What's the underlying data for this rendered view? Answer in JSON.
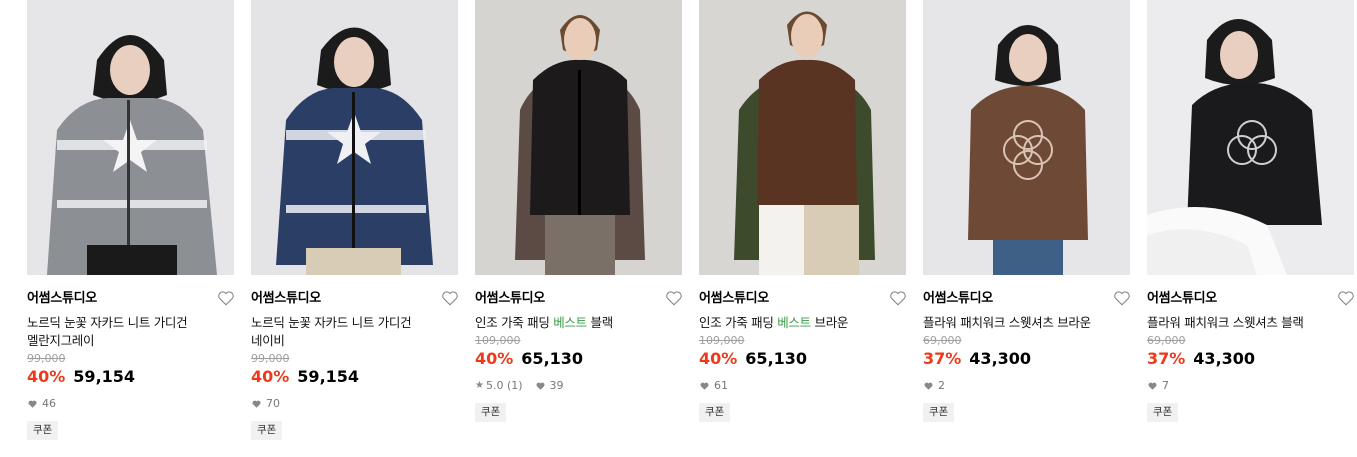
{
  "products": [
    {
      "brand": "어썸스튜디오",
      "name_line1": "노르딕 눈꽃 자카드 니트 가디건",
      "name_line2": "멜란지그레이",
      "original_price": "99,000",
      "discount": "40%",
      "price": "59,154",
      "rating": "",
      "likes": "46",
      "coupon": "쿠폰",
      "colors": {
        "bg": "#e6e6e8",
        "garment": "#8c8f94",
        "pattern": "#f4f4f4"
      }
    },
    {
      "brand": "어썸스튜디오",
      "name_line1": "노르딕 눈꽃 자카드 니트 가디건",
      "name_line2": "네이비",
      "original_price": "99,000",
      "discount": "40%",
      "price": "59,154",
      "rating": "",
      "likes": "70",
      "coupon": "쿠폰",
      "colors": {
        "bg": "#e4e4e6",
        "garment": "#2a3e66",
        "pattern": "#eef0f4"
      }
    },
    {
      "brand": "어썸스튜디오",
      "name_pre": "인조 가죽 패딩 ",
      "name_hl": "베스트",
      "name_post": " 블랙",
      "original_price": "109,000",
      "discount": "40%",
      "price": "65,130",
      "rating": "5.0 (1)",
      "likes": "39",
      "coupon": "쿠폰",
      "colors": {
        "bg": "#d6d4d1",
        "garment": "#1c1a1a",
        "pattern": "#5c4a45"
      }
    },
    {
      "brand": "어썸스튜디오",
      "name_pre": "인조 가죽 패딩 ",
      "name_hl": "베스트",
      "name_post": " 브라운",
      "original_price": "109,000",
      "discount": "40%",
      "price": "65,130",
      "rating": "",
      "likes": "61",
      "coupon": "쿠폰",
      "colors": {
        "bg": "#d8d6d3",
        "garment": "#5a3422",
        "pattern": "#3d4a2c"
      }
    },
    {
      "brand": "어썸스튜디오",
      "name_line1": "플라워 패치워크 스웻셔츠 브라운",
      "original_price": "69,000",
      "discount": "37%",
      "price": "43,300",
      "rating": "",
      "likes": "2",
      "coupon": "쿠폰",
      "colors": {
        "bg": "#e6e6e8",
        "garment": "#6e4a36",
        "pattern": "#d9c4b4"
      }
    },
    {
      "brand": "어썸스튜디오",
      "name_line1": "플라워 패치워크 스웻셔츠 블랙",
      "original_price": "69,000",
      "discount": "37%",
      "price": "43,300",
      "rating": "",
      "likes": "7",
      "coupon": "쿠폰",
      "colors": {
        "bg": "#ececee",
        "garment": "#1a1a1c",
        "pattern": "#cfcfcf"
      }
    }
  ],
  "icons": {
    "like": "heart-outline-icon",
    "likes": "heart-filled-icon",
    "rating": "star-icon"
  }
}
